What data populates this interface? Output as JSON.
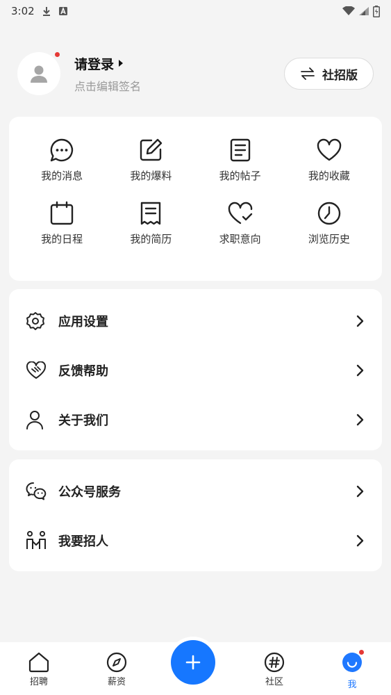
{
  "status_bar": {
    "time": "3:02"
  },
  "profile": {
    "login_label": "请登录",
    "signature": "点击编辑签名",
    "mode_button": "社招版"
  },
  "quick_grid": [
    {
      "label": "我的消息",
      "icon": "chat-bubble-icon"
    },
    {
      "label": "我的爆料",
      "icon": "edit-icon"
    },
    {
      "label": "我的帖子",
      "icon": "document-icon"
    },
    {
      "label": "我的收藏",
      "icon": "heart-icon"
    },
    {
      "label": "我的日程",
      "icon": "calendar-icon"
    },
    {
      "label": "我的简历",
      "icon": "resume-icon"
    },
    {
      "label": "求职意向",
      "icon": "heart-check-icon"
    },
    {
      "label": "浏览历史",
      "icon": "clock-icon"
    }
  ],
  "menu_1": [
    {
      "label": "应用设置",
      "icon": "gear-icon"
    },
    {
      "label": "反馈帮助",
      "icon": "handshake-heart-icon"
    },
    {
      "label": "关于我们",
      "icon": "person-icon"
    }
  ],
  "menu_2": [
    {
      "label": "公众号服务",
      "icon": "wechat-icon"
    },
    {
      "label": "我要招人",
      "icon": "recruit-icon"
    }
  ],
  "bottom_nav": {
    "items": [
      {
        "label": "招聘",
        "icon": "home-icon"
      },
      {
        "label": "薪资",
        "icon": "compass-icon"
      },
      {
        "label": "社区",
        "icon": "hashtag-icon"
      },
      {
        "label": "我",
        "icon": "smile-icon"
      }
    ],
    "active": "我"
  },
  "colors": {
    "accent": "#1677ff",
    "badge": "#e53935",
    "background": "#f4f4f4"
  }
}
